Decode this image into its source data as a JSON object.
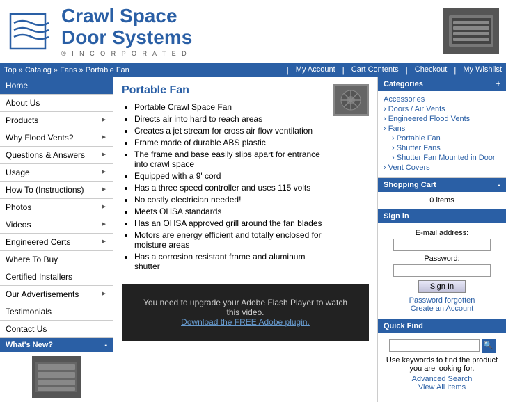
{
  "header": {
    "logo_line1": "Crawl Space",
    "logo_line2": "Door Systems",
    "logo_sub": "® I N C O R P O R A T E D",
    "brand_color": "#2a5fa5"
  },
  "navbar": {
    "breadcrumb": "Top » Catalog » Fans » Portable Fan",
    "links": [
      {
        "label": "My Account",
        "id": "my-account"
      },
      {
        "label": "Cart Contents",
        "id": "cart-contents"
      },
      {
        "label": "Checkout",
        "id": "checkout"
      },
      {
        "label": "My Wishlist",
        "id": "my-wishlist"
      }
    ]
  },
  "sidebar": {
    "items": [
      {
        "label": "Home",
        "has_arrow": false,
        "id": "home"
      },
      {
        "label": "About Us",
        "has_arrow": false,
        "id": "about-us"
      },
      {
        "label": "Products",
        "has_arrow": true,
        "id": "products"
      },
      {
        "label": "Why Flood Vents?",
        "has_arrow": true,
        "id": "why-flood-vents"
      },
      {
        "label": "Questions & Answers",
        "has_arrow": true,
        "id": "questions-answers"
      },
      {
        "label": "Usage",
        "has_arrow": true,
        "id": "usage"
      },
      {
        "label": "How To (Instructions)",
        "has_arrow": true,
        "id": "how-to"
      },
      {
        "label": "Photos",
        "has_arrow": true,
        "id": "photos"
      },
      {
        "label": "Videos",
        "has_arrow": true,
        "id": "videos"
      },
      {
        "label": "Engineered Certs",
        "has_arrow": true,
        "id": "engineered-certs"
      },
      {
        "label": "Where To Buy",
        "has_arrow": false,
        "id": "where-to-buy"
      },
      {
        "label": "Certified Installers",
        "has_arrow": false,
        "id": "certified-installers"
      },
      {
        "label": "Our Advertisements",
        "has_arrow": true,
        "id": "our-advertisements"
      },
      {
        "label": "Testimonials",
        "has_arrow": false,
        "id": "testimonials"
      },
      {
        "label": "Contact Us",
        "has_arrow": false,
        "id": "contact-us"
      }
    ],
    "whats_new_label": "What's New?",
    "whats_new_toggle": "-"
  },
  "content": {
    "title": "Portable Fan",
    "bullets": [
      "Portable Crawl Space Fan",
      "Directs air into hard to reach areas",
      "Creates a jet stream for cross air flow ventilation",
      "Frame made of durable ABS plastic",
      "The frame and base easily slips apart for entrance into crawl space",
      "Equipped with a 9' cord",
      "Has a three speed controller and uses 115 volts",
      "No costly electrician needed!",
      "Meets OHSA standards",
      "Has an OHSA approved grill around the fan blades",
      "Motors are energy efficient and totally enclosed for moisture areas",
      "Has a corrosion resistant frame and aluminum shutter"
    ],
    "video_message": "You need to upgrade your Adobe Flash Player to watch this video.",
    "video_link_text": "Download the FREE Adobe plugin.",
    "video_link_url": "#"
  },
  "right_sidebar": {
    "categories_label": "Categories",
    "categories_toggle": "+",
    "categories": [
      {
        "label": "Accessories",
        "sub": false
      },
      {
        "label": "Doors / Air Vents",
        "sub": false
      },
      {
        "label": "Engineered Flood Vents",
        "sub": false
      },
      {
        "label": "Fans",
        "sub": false
      },
      {
        "label": "Portable Fan",
        "sub": true
      },
      {
        "label": "Shutter Fans",
        "sub": true
      },
      {
        "label": "Shutter Fan Mounted in Door",
        "sub": true
      },
      {
        "label": "Vent Covers",
        "sub": false
      }
    ],
    "shopping_cart_label": "Shopping Cart",
    "shopping_cart_toggle": "-",
    "cart_items": "0 items",
    "signin_label": "Sign in",
    "email_label": "E-mail address:",
    "email_placeholder": "",
    "password_label": "Password:",
    "password_placeholder": "",
    "signin_btn": "Sign In",
    "password_forgotten": "Password forgotten",
    "create_account": "Create an Account",
    "quick_find_label": "Quick Find",
    "quick_find_desc": "Use keywords to find the product you are looking for.",
    "quick_find_placeholder": "",
    "advanced_search": "Advanced Search",
    "view_all_items": "View All Items"
  }
}
